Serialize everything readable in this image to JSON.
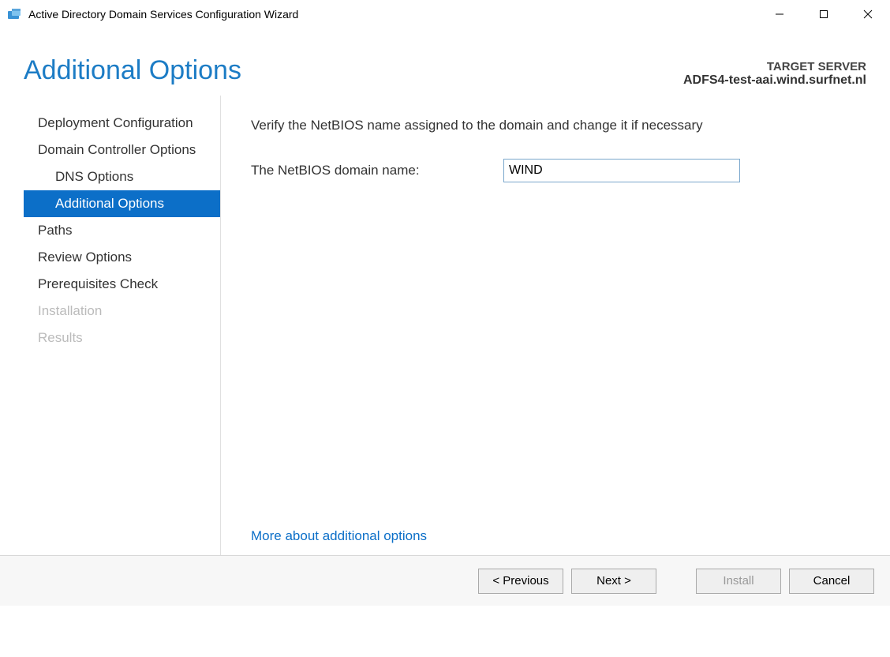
{
  "window": {
    "title": "Active Directory Domain Services Configuration Wizard"
  },
  "header": {
    "page_title": "Additional Options",
    "target_label": "TARGET SERVER",
    "target_value": "ADFS4-test-aai.wind.surfnet.nl"
  },
  "nav": {
    "items": [
      {
        "label": "Deployment Configuration",
        "indent": false,
        "state": "normal"
      },
      {
        "label": "Domain Controller Options",
        "indent": false,
        "state": "normal"
      },
      {
        "label": "DNS Options",
        "indent": true,
        "state": "normal"
      },
      {
        "label": "Additional Options",
        "indent": true,
        "state": "selected"
      },
      {
        "label": "Paths",
        "indent": false,
        "state": "normal"
      },
      {
        "label": "Review Options",
        "indent": false,
        "state": "normal"
      },
      {
        "label": "Prerequisites Check",
        "indent": false,
        "state": "normal"
      },
      {
        "label": "Installation",
        "indent": false,
        "state": "disabled"
      },
      {
        "label": "Results",
        "indent": false,
        "state": "disabled"
      }
    ]
  },
  "content": {
    "instruction": "Verify the NetBIOS name assigned to the domain and change it if necessary",
    "field_label": "The NetBIOS domain name:",
    "field_value": "WIND",
    "more_link": "More about additional options"
  },
  "footer": {
    "previous": "< Previous",
    "next": "Next >",
    "install": "Install",
    "cancel": "Cancel"
  }
}
